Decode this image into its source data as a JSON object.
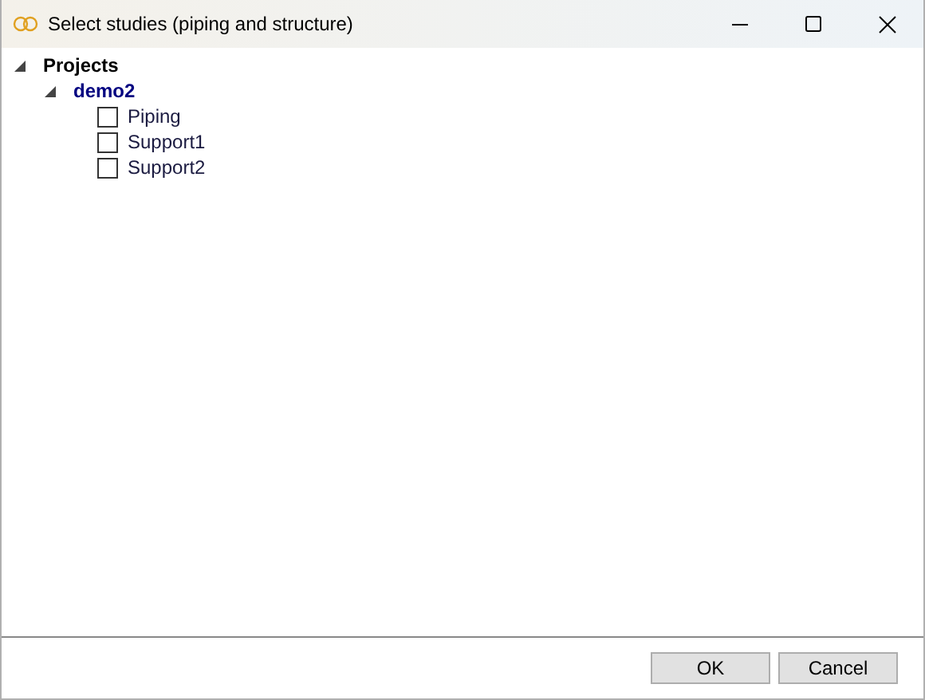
{
  "window": {
    "title": "Select studies (piping and structure)"
  },
  "tree": [
    {
      "label": "Projects",
      "expanded": true,
      "children": [
        {
          "label": "demo2",
          "expanded": true,
          "children": [
            {
              "label": "Piping",
              "checked": false
            },
            {
              "label": "Support1",
              "checked": false
            },
            {
              "label": "Support2",
              "checked": false
            }
          ]
        }
      ]
    }
  ],
  "buttons": [
    "OK",
    "Cancel"
  ]
}
